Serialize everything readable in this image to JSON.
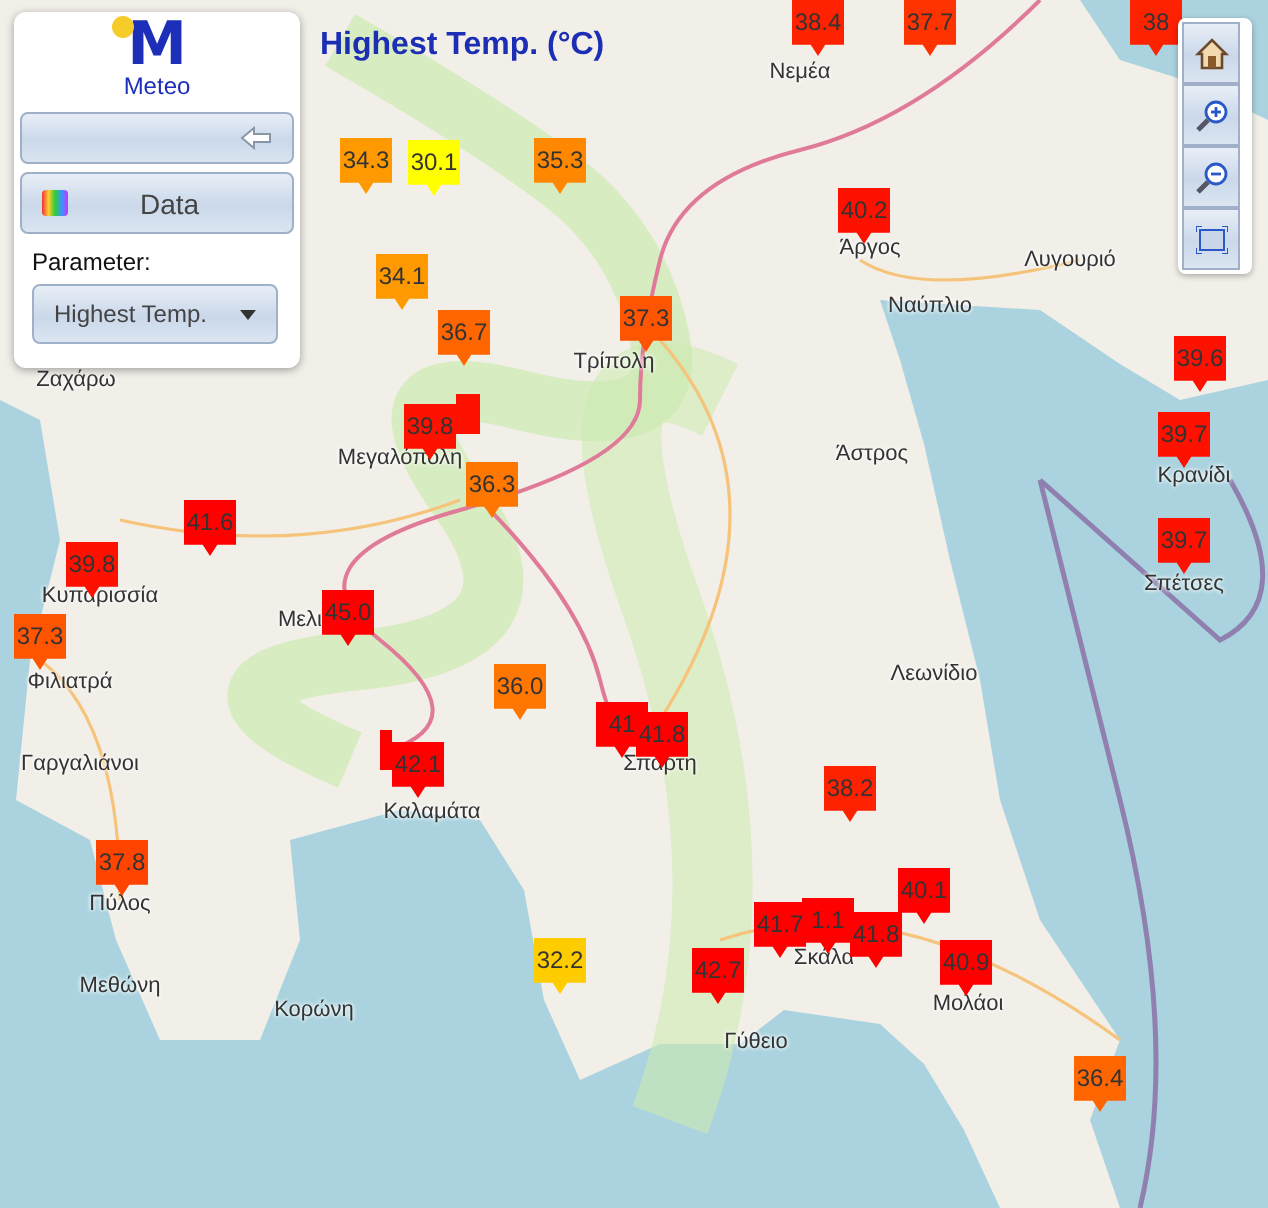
{
  "title": "Highest Temp. (°C)",
  "panel": {
    "logo": {
      "mark": "M",
      "name": "Meteo"
    },
    "data_button": "Data",
    "parameter_label": "Parameter:",
    "parameter_select": {
      "value": "Highest Temp."
    }
  },
  "map_controls": [
    {
      "kind": "home"
    },
    {
      "kind": "zoom_in"
    },
    {
      "kind": "zoom_out"
    },
    {
      "kind": "fit"
    }
  ],
  "places": [
    "Νεμέα",
    "Άργος",
    "Λυγουριό",
    "Ναύπλιο",
    "Ζαχάρω",
    "Τρίπολη",
    "Μεγαλόπολη",
    "Άστρος",
    "Κρανίδι",
    "Σπέτσες",
    "Κυπαρισσία",
    "Μελι",
    "Φιλιατρά",
    "Λεωνίδιο",
    "Γαργαλιάνοι",
    "Καλαμάτα",
    "Σπάρτη",
    "Πύλος",
    "Μεθώνη",
    "Κορώνη",
    "Σκάλα",
    "Γύθειο",
    "Μολάοι"
  ],
  "markers": [
    {
      "value": "38.4",
      "color": "#ff2200"
    },
    {
      "value": "37.7",
      "color": "#ff3300"
    },
    {
      "value": "38",
      "color": "#ff2200"
    },
    {
      "value": "34.3",
      "color": "#ff9900"
    },
    {
      "value": "30.1",
      "color": "#ffff00"
    },
    {
      "value": "35.3",
      "color": "#ff8800"
    },
    {
      "value": "40.2",
      "color": "#ff1100"
    },
    {
      "value": "34.1",
      "color": "#ff9900"
    },
    {
      "value": "36.7",
      "color": "#ff6600"
    },
    {
      "value": "37.3",
      "color": "#ff5500"
    },
    {
      "value": "39.6",
      "color": "#ff1100"
    },
    {
      "color": "#ff1100"
    },
    {
      "value": "39.8",
      "color": "#ff1100"
    },
    {
      "value": "39.7",
      "color": "#ff1100"
    },
    {
      "value": "36.3",
      "color": "#ff7700"
    },
    {
      "value": "41.6",
      "color": "#ff0000"
    },
    {
      "value": "39.7",
      "color": "#ff1100"
    },
    {
      "value": "39.8",
      "color": "#ff1100"
    },
    {
      "value": "45.0",
      "color": "#ff0000"
    },
    {
      "value": "37.3",
      "color": "#ff5500"
    },
    {
      "value": "36.0",
      "color": "#ff7700"
    },
    {
      "value": "41",
      "color": "#ff0000"
    },
    {
      "value": "41.8",
      "color": "#ff0000"
    },
    {
      "color": "#ff0000"
    },
    {
      "value": "42.1",
      "color": "#ff0000"
    },
    {
      "value": "38.2",
      "color": "#ff2200"
    },
    {
      "value": "37.8",
      "color": "#ff4400"
    },
    {
      "value": "40.1",
      "color": "#ff0000"
    },
    {
      "value": "1.1",
      "color": "#ff0000"
    },
    {
      "value": "41.7",
      "color": "#ff0000"
    },
    {
      "value": "41.8",
      "color": "#ff0000"
    },
    {
      "value": "32.2",
      "color": "#ffcc00"
    },
    {
      "value": "42.7",
      "color": "#ff0000"
    },
    {
      "value": "40.9",
      "color": "#ff0000"
    },
    {
      "value": "36.4",
      "color": "#ff6600"
    }
  ]
}
